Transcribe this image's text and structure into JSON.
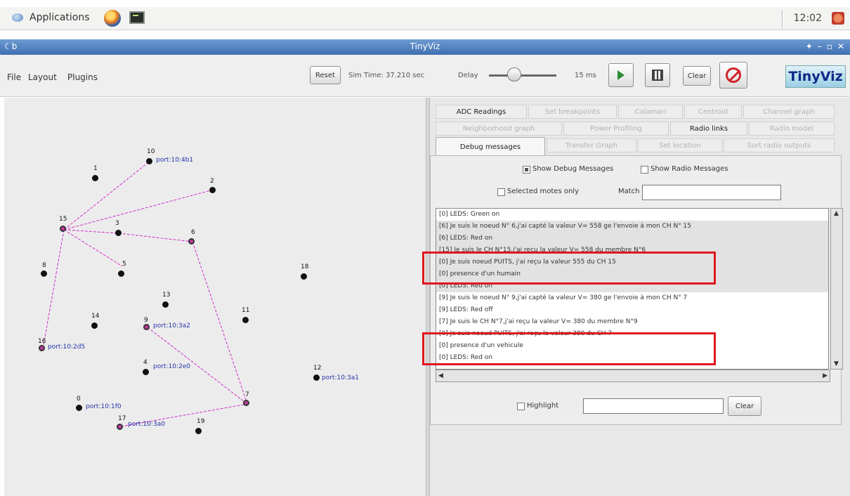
{
  "desktop_panel": {
    "apps_label": "Applications",
    "clock": "12:02",
    "icons": [
      "applications-icon",
      "firefox-icon",
      "terminal-icon",
      "logout-icon"
    ]
  },
  "window": {
    "title": "TinyViz",
    "icon_label": "☾b",
    "controls": [
      "✦",
      "–",
      "▫",
      "✕"
    ],
    "title_color": "#4f7fc0"
  },
  "toolbar": {
    "menus": [
      "File",
      "Layout",
      "Plugins"
    ],
    "reset_label": "Reset",
    "sim_time_label": "Sim Time: 37.210 sec",
    "delay_label": "Delay",
    "delay_value": "15 ms",
    "clear_label": "Clear",
    "logo_text": "TinyViz",
    "icons": [
      "play-icon",
      "grid-icon",
      "stop-icon"
    ]
  },
  "tabs": {
    "row1": [
      "ADC Readings",
      "Set breakpoints",
      "Calamari",
      "Centroid",
      "Channel graph"
    ],
    "row2": [
      "Neighborhood graph",
      "Power Profiling",
      "Radio links",
      "Radio model"
    ],
    "row3": [
      "Debug messages",
      "Transfer Graph",
      "Set location",
      "Sort radio outputs"
    ],
    "selected": "Debug messages",
    "active": [
      "ADC Readings",
      "Radio links",
      "Debug messages"
    ]
  },
  "debug_panel": {
    "show_debug": "Show Debug Messages",
    "show_radio": "Show Radio Messages",
    "selected_only": "Selected motes only",
    "match_label": "Match",
    "match_value": "",
    "highlight_label": "Highlight",
    "highlight_value": "",
    "clear_label": "Clear",
    "log_lines": [
      "[0] LEDS: Green on",
      "[6] Je suis le noeud N° 6,j'ai capté la valeur V= 558 ge l'envoie à mon CH N° 15",
      "[6] LEDS: Red on",
      "[15] Je suis le CH N°15,j'ai reçu la valeur V= 558 du membre N°6",
      "[0] Je suis noeud PUITS, j'ai reçu la valeur 555 du CH 15",
      "[0] presence d'un humain",
      "[0] LEDS: Red on",
      "[9] Je suis le noeud N° 9,j'ai capté la valeur V= 380 ge l'envoie à mon CH N° 7",
      "[9] LEDS: Red off",
      "[7] Je suis le CH N°7,j'ai reçu la valeur V= 380 du membre N°9",
      "[0] Je suis noeud PUITS, j'ai reçu la valeur 380 du CH 7",
      "[0] presence d'un vehicule",
      "[0] LEDS: Red on"
    ]
  },
  "network": {
    "motes": [
      {
        "id": "10",
        "label": "port:10:4b1"
      },
      {
        "id": "1",
        "label": ""
      },
      {
        "id": "2",
        "label": ""
      },
      {
        "id": "15",
        "label": ""
      },
      {
        "id": "3",
        "label": ""
      },
      {
        "id": "6",
        "label": ""
      },
      {
        "id": "5",
        "label": ""
      },
      {
        "id": "8",
        "label": ""
      },
      {
        "id": "18",
        "label": ""
      },
      {
        "id": "13",
        "label": ""
      },
      {
        "id": "11",
        "label": ""
      },
      {
        "id": "14",
        "label": ""
      },
      {
        "id": "9",
        "label": "port:10:3a2"
      },
      {
        "id": "16",
        "label": "port:10:2d5"
      },
      {
        "id": "4",
        "label": "port:10:2e0"
      },
      {
        "id": "7",
        "label": ""
      },
      {
        "id": "12",
        "label": "port:10:3a1"
      },
      {
        "id": "0",
        "label": "port:10:1f0"
      },
      {
        "id": "17",
        "label": "port:10:3a0"
      },
      {
        "id": "19",
        "label": ""
      }
    ],
    "link_color": "#d02fc8"
  },
  "highlight_box_color": "#e0171f"
}
